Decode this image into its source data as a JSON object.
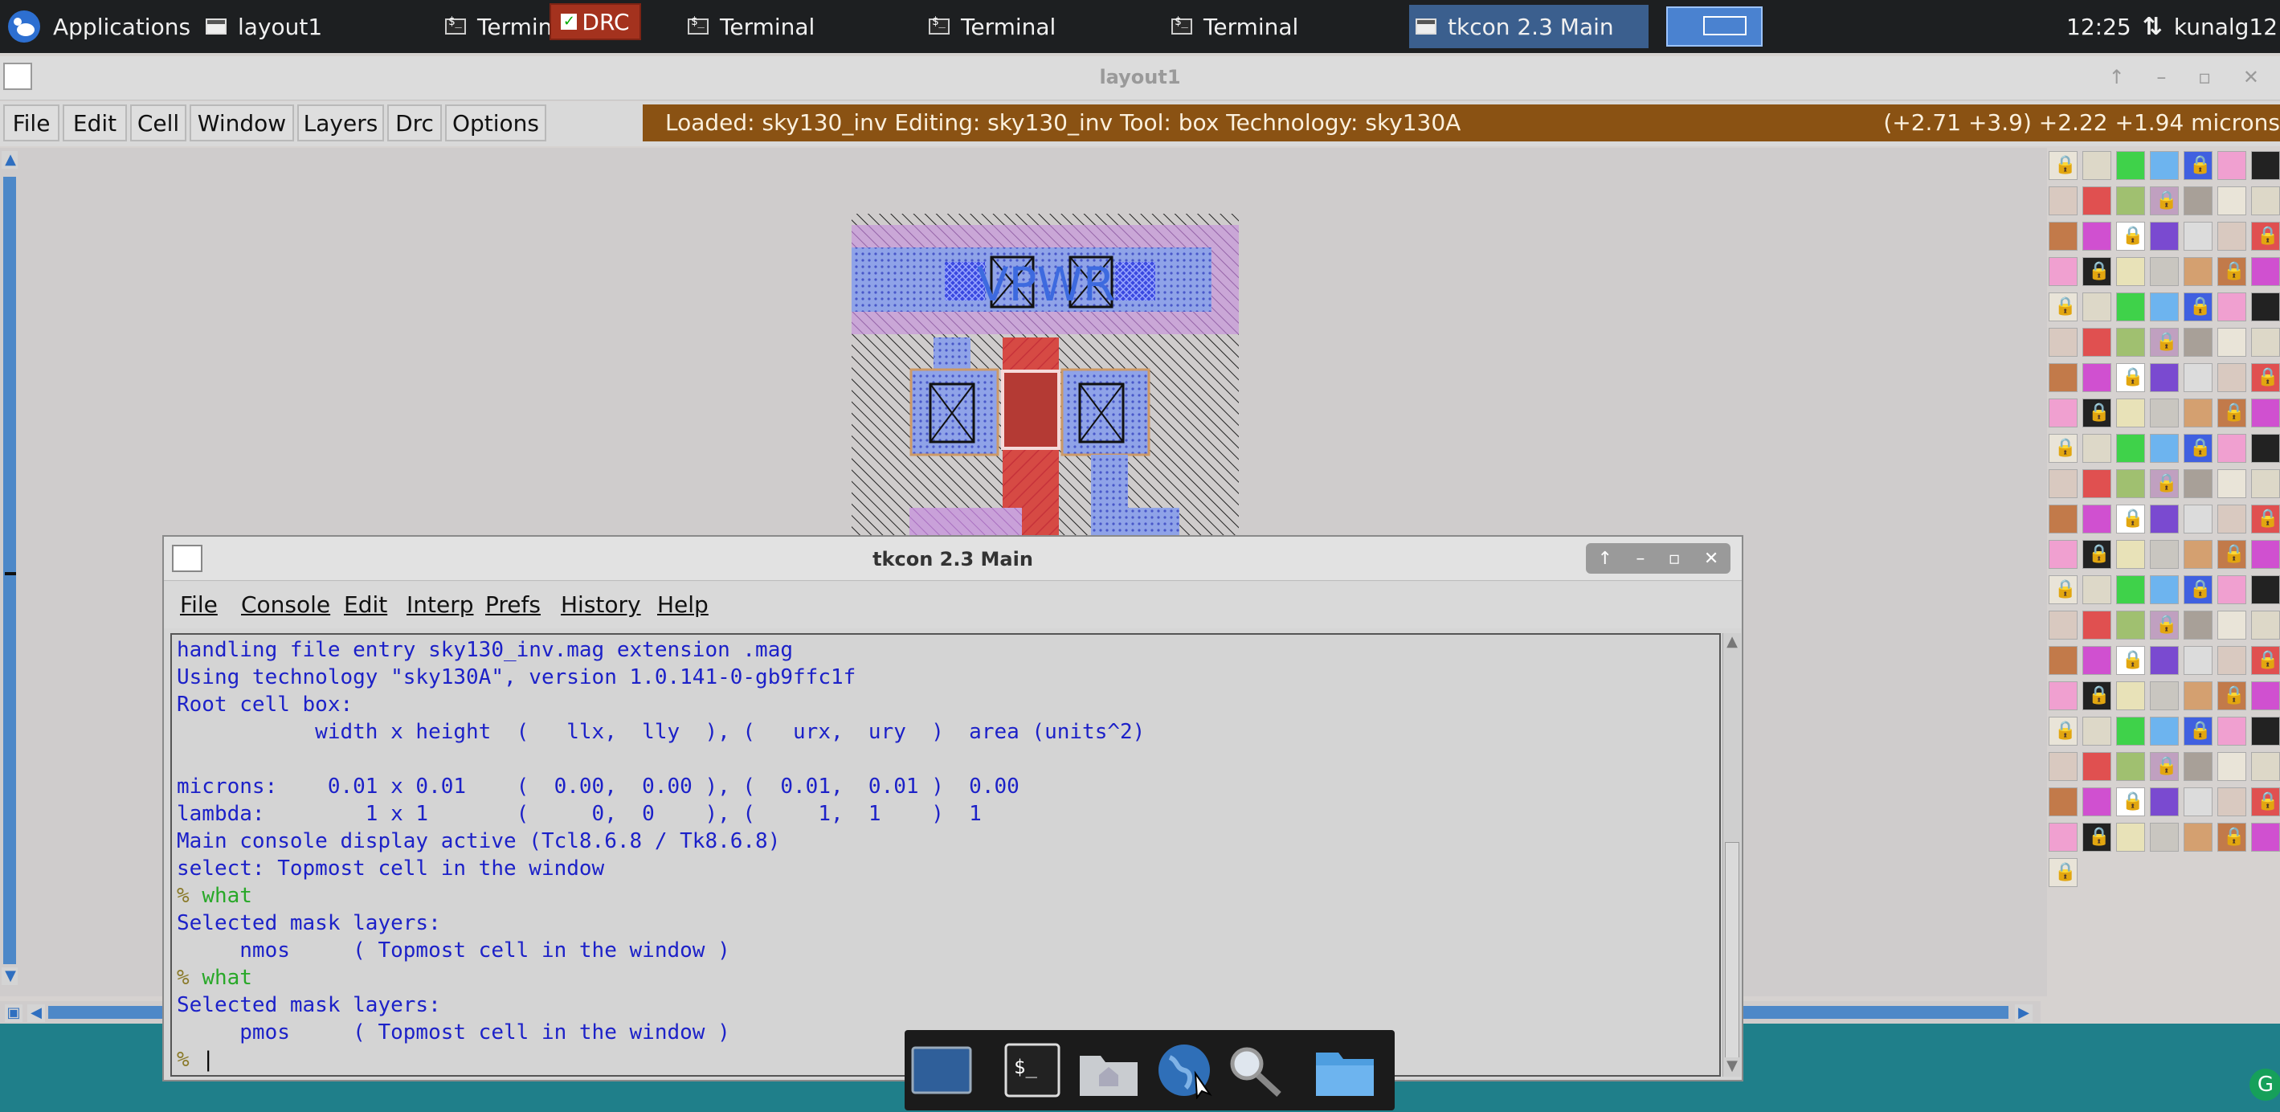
{
  "taskbar": {
    "applications_label": "Applications",
    "items": [
      {
        "label": "layout1",
        "icon": "window-icon"
      },
      {
        "label": "Terminal",
        "icon": "terminal-icon"
      },
      {
        "label": "Terminal",
        "icon": "terminal-icon"
      },
      {
        "label": "Terminal",
        "icon": "terminal-icon"
      },
      {
        "label": "Terminal",
        "icon": "terminal-icon"
      },
      {
        "label": "tkcon 2.3 Main",
        "icon": "window-icon",
        "active": true
      }
    ],
    "clock": "12:25",
    "user": "kunalg12"
  },
  "layout_window": {
    "title": "layout1",
    "menu": [
      "File",
      "Edit",
      "Cell",
      "Window",
      "Layers",
      "Drc",
      "Options"
    ],
    "drc_label": "DRC",
    "status": "Loaded: sky130_inv Editing: sky130_inv Tool: box  Technology: sky130A",
    "coords": "(+2.71 +3.9) +2.22 +1.94 microns",
    "layout_label": "VPWR"
  },
  "tkcon": {
    "title": "tkcon 2.3 Main",
    "menu": [
      "File",
      "Console",
      "Edit",
      "Interp",
      "Prefs",
      "History",
      "Help"
    ],
    "lines": [
      {
        "text": "handling file entry sky130_inv.mag extension .mag"
      },
      {
        "text": "Using technology \"sky130A\", version 1.0.141-0-gb9ffc1f"
      },
      {
        "text": "Root cell box:"
      },
      {
        "text": "           width x height  (   llx,  lly  ), (   urx,  ury  )  area (units^2)"
      },
      {
        "text": ""
      },
      {
        "text": "microns:    0.01 x 0.01    (  0.00,  0.00 ), (  0.01,  0.01 )  0.00"
      },
      {
        "text": "lambda:        1 x 1       (     0,  0    ), (     1,  1    )  1"
      },
      {
        "text": "Main console display active (Tcl8.6.8 / Tk8.6.8)"
      },
      {
        "text": "select: Topmost cell in the window"
      },
      {
        "prompt": "% ",
        "cmd": "what"
      },
      {
        "text": "Selected mask layers:"
      },
      {
        "text": "     nmos     ( Topmost cell in the window )"
      },
      {
        "prompt": "% ",
        "cmd": "what"
      },
      {
        "text": "Selected mask layers:"
      },
      {
        "text": "     pmos     ( Topmost cell in the window )"
      },
      {
        "prompt": "% ",
        "cmd": ""
      }
    ]
  },
  "colors": {
    "status_bar": "#8a5213",
    "drc_button": "#a4321e",
    "console_text": "#1c21c8",
    "console_cmd": "#28a828"
  },
  "dock_icons": [
    "screen-icon",
    "terminal-icon",
    "home-folder-icon",
    "browser-globe-icon",
    "search-magnifier-icon",
    "folder-icon"
  ]
}
